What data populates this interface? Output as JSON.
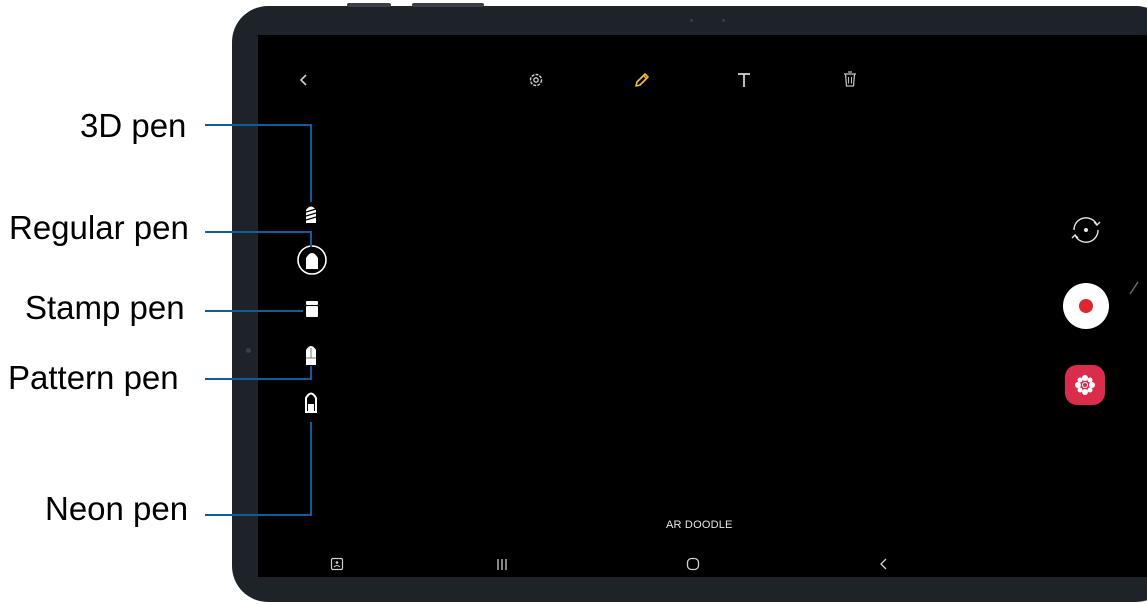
{
  "toolbar": {
    "back_icon": "back-chevron-icon",
    "settings_icon": "gear-icon",
    "pen_icon": "pencil-icon",
    "text_icon": "text-T-icon",
    "delete_icon": "trash-icon",
    "pen_color": "#f2c31b"
  },
  "pens": [
    {
      "label": "3D pen",
      "icon": "3d-pen-icon"
    },
    {
      "label": "Regular pen",
      "icon": "regular-pen-icon",
      "selected": true
    },
    {
      "label": "Stamp pen",
      "icon": "stamp-pen-icon"
    },
    {
      "label": "Pattern pen",
      "icon": "pattern-pen-icon"
    },
    {
      "label": "Neon pen",
      "icon": "neon-pen-icon"
    }
  ],
  "right_controls": {
    "switch_camera_icon": "camera-switch-icon",
    "record_icon": "record-icon",
    "sticker_icon": "sticker-icon",
    "record_color": "#e0262d",
    "sticker_color": "#d92d4b"
  },
  "mode_label": "AR DOODLE",
  "nav_bar": [
    "screenshot-icon",
    "recent-apps-icon",
    "home-icon",
    "back-icon"
  ],
  "callout_line_color": "#0d5e9d"
}
